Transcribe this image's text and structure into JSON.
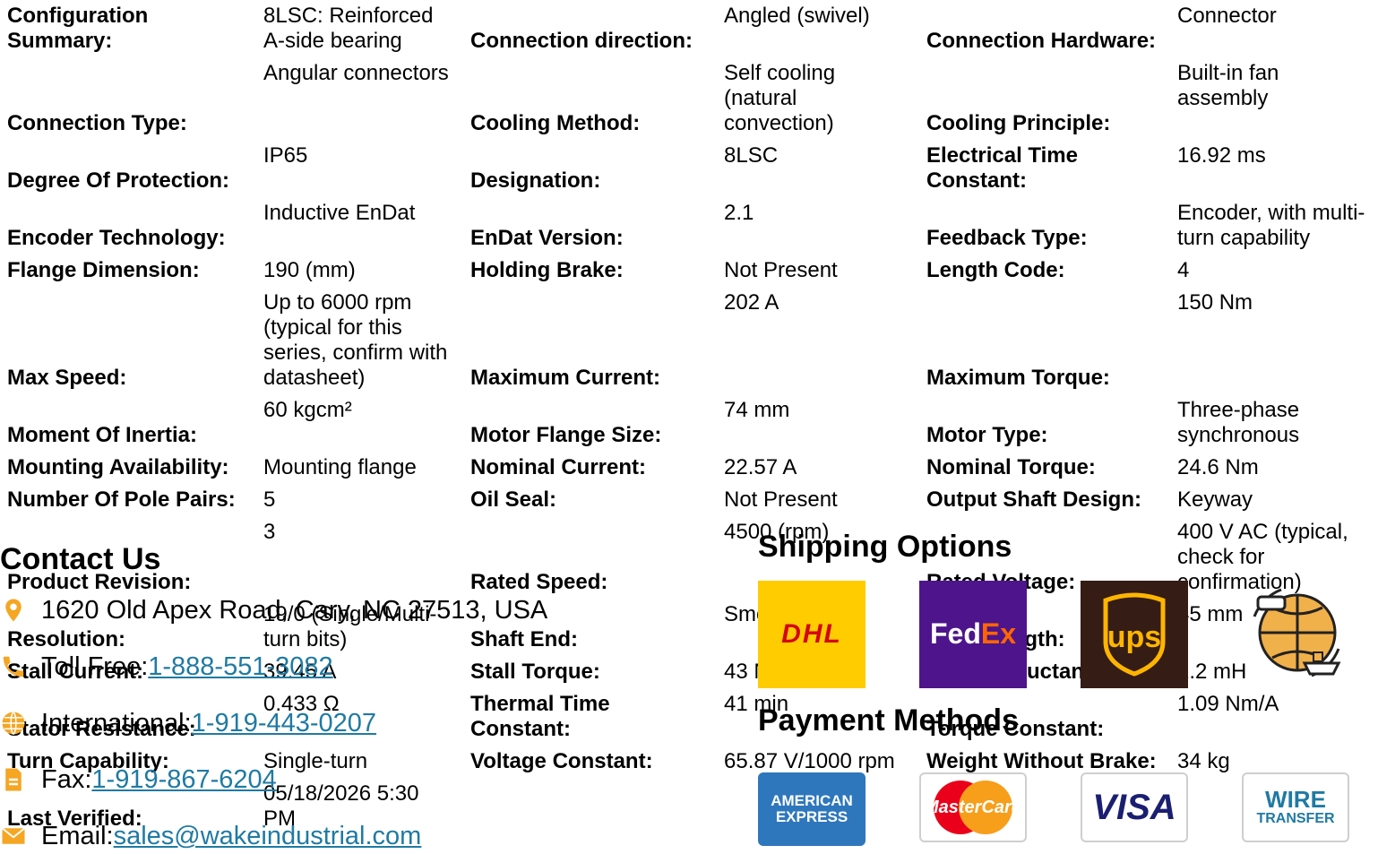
{
  "specs": [
    [
      "Configuration Summary:",
      "8LSC: Reinforced A-side bearing",
      "Connection direction:",
      "Angled (swivel)",
      "Connection Hardware:",
      "Connector"
    ],
    [
      "Connection Type:",
      "Angular connectors",
      "Cooling Method:",
      "Self cooling (natural convection)",
      "Cooling Principle:",
      "Built-in fan assembly"
    ],
    [
      "Degree Of Protection:",
      "IP65",
      "Designation:",
      "8LSC",
      "Electrical Time Constant:",
      "16.92 ms"
    ],
    [
      "Encoder Technology:",
      "Inductive EnDat",
      "EnDat Version:",
      "2.1",
      "Feedback Type:",
      "Encoder, with multi-turn capability"
    ],
    [
      "Flange Dimension:",
      "190 (mm)",
      "Holding Brake:",
      "Not Present",
      "Length Code:",
      "4"
    ],
    [
      "Max Speed:",
      "Up to 6000 rpm (typical for this series, confirm with datasheet)",
      "Maximum Current:",
      "202 A",
      "Maximum Torque:",
      "150 Nm"
    ],
    [
      "Moment Of Inertia:",
      "60 kgcm²",
      "Motor Flange Size:",
      "74 mm",
      "Motor Type:",
      "Three-phase synchronous"
    ],
    [
      "Mounting Availability:",
      "Mounting flange",
      "Nominal Current:",
      "22.57 A",
      "Nominal Torque:",
      "24.6 Nm"
    ],
    [
      "Number Of Pole Pairs:",
      "5",
      "Oil Seal:",
      "Not Present",
      "Output Shaft Design:",
      "Keyway"
    ],
    [
      "Product Revision:",
      "3",
      "Rated Speed:",
      "4500 (rpm)",
      "Rated Voltage:",
      "400 V AC (typical, check for confirmation)"
    ],
    [
      "Resolution:",
      "19/0 (Single/Multi-turn bits)",
      "Shaft End:",
      "Smooth",
      "Shaft Length:",
      "45 mm"
    ],
    [
      "Stall Current:",
      "39.45 A",
      "Stall Torque:",
      "43 Nm",
      "Stator Inductance:",
      "2.2 mH"
    ],
    [
      "Stator Resistance:",
      "0.433 Ω",
      "Thermal Time Constant:",
      "41 min",
      "Torque Constant:",
      "1.09 Nm/A"
    ],
    [
      "Turn Capability:",
      "Single-turn",
      "Voltage Constant:",
      "65.87 V/1000 rpm",
      "Weight Without Brake:",
      "34 kg"
    ],
    [
      "Last Verified:",
      "05/18/2026 5:30 PM",
      "",
      "",
      "",
      ""
    ]
  ],
  "contact": {
    "title": "Contact Us",
    "address": "1620 Old Apex Road, Cary, NC 27513, USA",
    "toll_free_label": "Toll Free: ",
    "toll_free": "1-888-551-3082",
    "international_label": "International: ",
    "international": "1-919-443-0207",
    "fax_label": "Fax: ",
    "fax": "1-919-867-6204",
    "email_label": "Email: ",
    "email": "sales@wakeindustrial.com"
  },
  "shipping": {
    "title": "Shipping Options",
    "carriers": [
      "DHL",
      "FedEx",
      "ups"
    ]
  },
  "payment": {
    "title": "Payment Methods",
    "cards": {
      "amex_line1": "AMERICAN",
      "amex_line2": "EXPRESS",
      "mastercard": "MasterCard",
      "visa": "VISA",
      "wire_line1": "WIRE",
      "wire_line2": "TRANSFER"
    }
  },
  "colors": {
    "link": "#1f7aa3",
    "icon": "#f5a623",
    "dhl_bg": "#ffcc00",
    "dhl_text": "#d40511",
    "fedex_bg": "#4d148c",
    "fedex_orange": "#ff6600",
    "ups_bg": "#351c15",
    "ups_gold": "#ffb500",
    "amex": "#2e77bc",
    "visa": "#1a1f71",
    "wire": "#1f7aa3"
  }
}
